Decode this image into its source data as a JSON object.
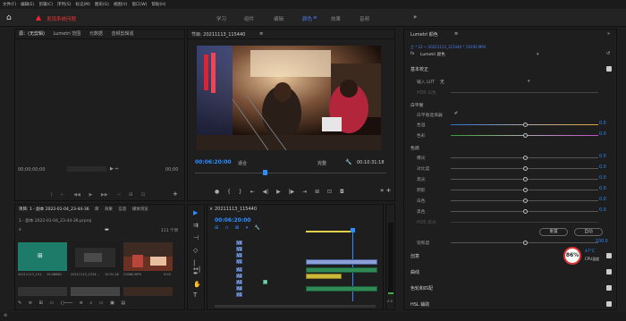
{
  "menu": [
    "文件(F)",
    "编辑(E)",
    "剪辑(C)",
    "序列(S)",
    "标记(M)",
    "图形(G)",
    "视图(V)",
    "窗口(W)",
    "帮助(H)"
  ],
  "header": {
    "alert": "发现系统问题",
    "workspaces": [
      "学习",
      "组件",
      "编辑",
      "颜色",
      "效果",
      "音频"
    ],
    "more": "»"
  },
  "source": {
    "tabs": [
      "源：(无剪辑)",
      "Lumetri 范围",
      "元数据",
      "音频剪辑混"
    ],
    "time_left": "00;00;00;00",
    "time_right": "00;00"
  },
  "program": {
    "title": "节目: 20211113_115440",
    "timecode": "00:06:20:00",
    "fit": "适合",
    "quality": "完整",
    "duration": "00:10:31:18"
  },
  "project": {
    "tabs": [
      "项目: 1 - 副本 2022-01-04_23-44-36",
      "库",
      "效果",
      "信息",
      "媒体浏览"
    ],
    "file": "1 - 副本 2022-01-04_23-44-36.prproj",
    "count": "111 个项",
    "thumbs": [
      {
        "name": "20211113_141..",
        "dur": "15:08680"
      },
      {
        "name": "20211113_1534...",
        "dur": "10:31:18"
      },
      {
        "name": "C0080.MP4",
        "dur": "5:03"
      }
    ]
  },
  "timeline": {
    "title": "20211113_115440",
    "timecode": "00:06:20:00",
    "video_tracks": [
      "V4",
      "V3",
      "V2",
      "V1"
    ],
    "audio_tracks": [
      "A1",
      "A2",
      "A3",
      "A4",
      "A5"
    ],
    "db": "-S S"
  },
  "lumetri": {
    "title": "Lumetri 颜色",
    "source_line": "主 * 22 ~ 20211113_115440 * C0192.MP4",
    "fx": "Lumetri 颜色",
    "basic": "基本校正",
    "input_lut": "输入 LUT",
    "input_lut_val": "无",
    "hdr_white": "HDR 白色",
    "white_balance": "白平衡",
    "wb_selector": "白平衡选择器",
    "temp": "色温",
    "temp_val": "0.0",
    "tint": "色彩",
    "tint_val": "0.0",
    "tone": "色调",
    "rows": [
      {
        "label": "曝光",
        "val": "0.0"
      },
      {
        "label": "对比度",
        "val": "0.0"
      },
      {
        "label": "高光",
        "val": "0.0"
      },
      {
        "label": "阴影",
        "val": "0.0"
      },
      {
        "label": "白色",
        "val": "0.0"
      },
      {
        "label": "黑色",
        "val": "0.0"
      },
      {
        "label": "HDR 高光",
        "val": ""
      }
    ],
    "reset": "重置",
    "auto": "自动",
    "saturation": "饱和度",
    "sat_val": "100.0",
    "creative": "创意",
    "curves": "曲线",
    "color_wheels": "色轮和匹配",
    "hsl": "HSL 辅助",
    "cpu_pct": "86%",
    "cpu_temp": "47°C",
    "cpu_label": "CPU温度"
  }
}
